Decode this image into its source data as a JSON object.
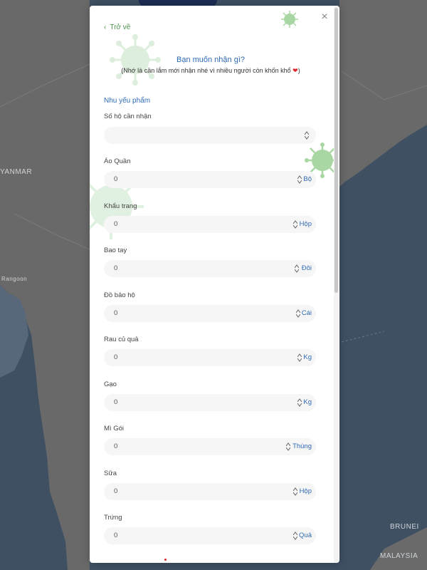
{
  "map": {
    "labels": [
      "YANMAR",
      "Rangoon",
      "BRUNEI",
      "MALAYSIA"
    ]
  },
  "modal": {
    "back_label": "Trở về",
    "close_label": "×",
    "title": "Bạn muốn nhận gì?",
    "subtitle": "(Nhớ là cần lắm mới nhận nhé vì nhiều người còn khốn khổ ",
    "subtitle_end": ")",
    "heart": "❤",
    "section_label": "Nhu yếu phẩm"
  },
  "fields": [
    {
      "label": "Số hộ cần nhận",
      "value": "",
      "unit": ""
    },
    {
      "label": "Áo Quần",
      "value": "0",
      "unit": "Bộ"
    },
    {
      "label": "Khẩu trang",
      "value": "0",
      "unit": "Hộp"
    },
    {
      "label": "Bao tay",
      "value": "0",
      "unit": "Đôi"
    },
    {
      "label": "Đồ bảo hộ",
      "value": "0",
      "unit": "Cái"
    },
    {
      "label": "Rau củ quả",
      "value": "0",
      "unit": "Kg"
    },
    {
      "label": "Gạo",
      "value": "0",
      "unit": "Kg"
    },
    {
      "label": "Mì Gói",
      "value": "0",
      "unit": "Thùng"
    },
    {
      "label": "Sữa",
      "value": "0",
      "unit": "Hộp"
    },
    {
      "label": "Trứng",
      "value": "0",
      "unit": "Quả"
    }
  ],
  "colors": {
    "accent_blue": "#2f6ab3",
    "back_green": "#4c8f4c",
    "heart_red": "#e0262a"
  }
}
